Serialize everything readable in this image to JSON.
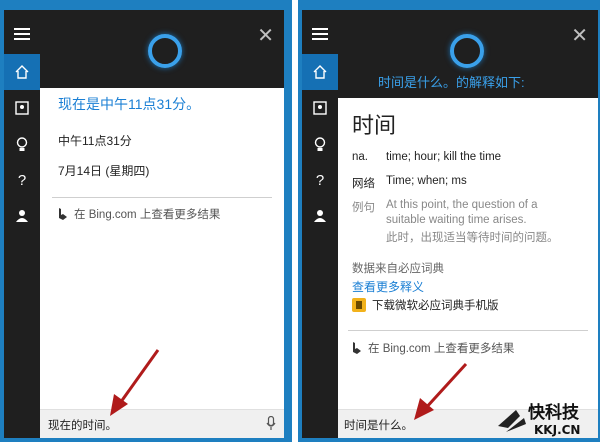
{
  "left": {
    "time_heading": "现在是中午11点31分。",
    "time_value": "中午11点31分",
    "date_value": "7月14日 (星期四)",
    "bing_link": "在 Bing.com 上查看更多结果",
    "query": "现在的时间。"
  },
  "right": {
    "header_text": "时间是什么。的解释如下:",
    "word": "时间",
    "rows": [
      {
        "label": "na.",
        "text": "time; hour; kill the time"
      },
      {
        "label": "网络",
        "text": "Time; when; ms"
      }
    ],
    "example_label": "例句",
    "example_en_lines": [
      "At this point, the question of a",
      "suitable waiting time arises."
    ],
    "example_zh": "此时，出现适当等待时间的问题。",
    "source": "数据来自必应词典",
    "more_link": "查看更多释义",
    "download_link": "下载微软必应词典手机版",
    "bing_link": "在 Bing.com 上查看更多结果",
    "query": "时间是什么。"
  },
  "colors": {
    "accent": "#1e7fc0",
    "dark": "#1f1f1f",
    "link": "#1a7fd4",
    "arrow": "#b01b1b"
  },
  "icons": [
    "menu-icon",
    "home-icon",
    "notebook-icon",
    "lightbulb-icon",
    "question-icon",
    "feedback-icon",
    "close-icon",
    "microphone-icon",
    "bing-logo-icon",
    "dictionary-icon"
  ],
  "brand": {
    "name": "快科技",
    "domain": "KKJ.CN"
  }
}
